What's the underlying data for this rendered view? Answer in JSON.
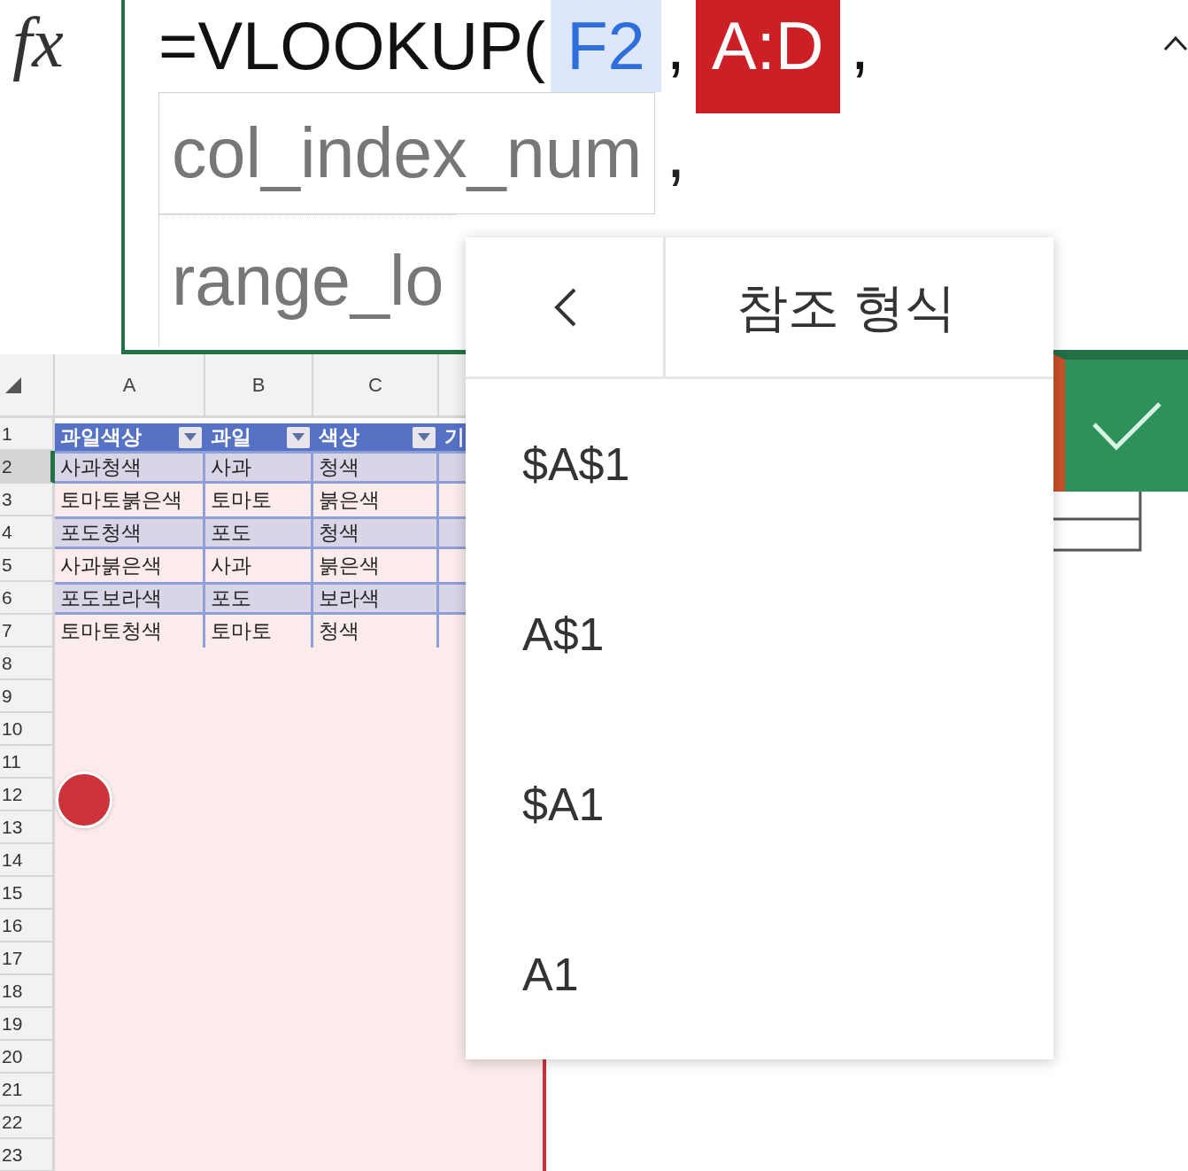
{
  "formula_bar": {
    "fx_label": "fx",
    "tokens": [
      {
        "text": "=VLOOKUP(",
        "kind": "plain"
      },
      {
        "text": "F2",
        "kind": "ref-light",
        "color": "#2f6fdc"
      },
      {
        "text": ",",
        "kind": "plain"
      },
      {
        "text": "A:D",
        "kind": "ref-solid",
        "color": "#cc1f26"
      },
      {
        "text": ",",
        "kind": "plain"
      }
    ],
    "arguments": [
      {
        "text": "col_index_num",
        "separator": ","
      },
      {
        "text": "range_lo"
      }
    ]
  },
  "sheet": {
    "columns": [
      "A",
      "B",
      "C",
      ""
    ],
    "rows": [
      {
        "label": "1",
        "selected": false
      },
      {
        "label": "2",
        "selected": true
      },
      {
        "label": "3",
        "selected": false
      },
      {
        "label": "4",
        "selected": false
      },
      {
        "label": "5",
        "selected": false
      },
      {
        "label": "6",
        "selected": false
      },
      {
        "label": "7",
        "selected": false
      },
      {
        "label": "8",
        "selected": false
      },
      {
        "label": "9",
        "selected": false
      },
      {
        "label": "10",
        "selected": false
      },
      {
        "label": "11",
        "selected": false
      },
      {
        "label": "12",
        "selected": false
      },
      {
        "label": "13",
        "selected": false
      },
      {
        "label": "14",
        "selected": false
      },
      {
        "label": "15",
        "selected": false
      },
      {
        "label": "16",
        "selected": false
      },
      {
        "label": "17",
        "selected": false
      },
      {
        "label": "18",
        "selected": false
      },
      {
        "label": "19",
        "selected": false
      },
      {
        "label": "20",
        "selected": false
      },
      {
        "label": "21",
        "selected": false
      },
      {
        "label": "22",
        "selected": false
      },
      {
        "label": "23",
        "selected": false
      }
    ],
    "table": {
      "headers": [
        {
          "text": "과일색상",
          "filter": true
        },
        {
          "text": "과일",
          "filter": true
        },
        {
          "text": "색상",
          "filter": true
        },
        {
          "text": "기",
          "filter": false
        }
      ],
      "rows": [
        [
          "사과청색",
          "사과",
          "청색"
        ],
        [
          "토마토붉은색",
          "토마토",
          "붉은색"
        ],
        [
          "포도청색",
          "포도",
          "청색"
        ],
        [
          "사과붉은색",
          "사과",
          "붉은색"
        ],
        [
          "포도보라색",
          "포도",
          "보라색"
        ],
        [
          "토마토청색",
          "토마토",
          "청색"
        ]
      ]
    }
  },
  "menu": {
    "title": "참조 형식",
    "items": [
      "$A$1",
      "A$1",
      "$A1",
      "A1"
    ]
  }
}
